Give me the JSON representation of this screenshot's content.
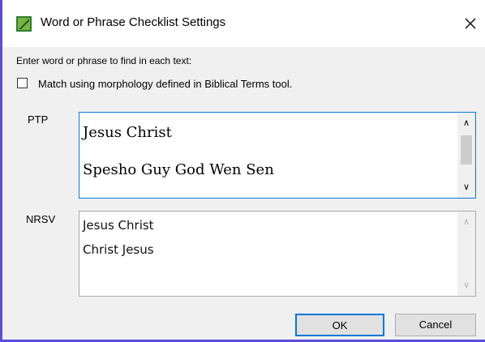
{
  "window": {
    "title": "Word or Phrase Checklist Settings",
    "icon": "app-checklist-icon",
    "accent_color": "#5b4fd9"
  },
  "prompt": "Enter word or phrase to find in each text:",
  "morphology_checkbox": {
    "label": "Match using morphology defined in Biblical Terms tool.",
    "checked": false
  },
  "ptp": {
    "label": "PTP",
    "lines": [
      "Jesus Christ",
      "Spesho Guy God Wen Sen"
    ]
  },
  "nrsv": {
    "label": "NRSV",
    "lines": [
      "Jesus Christ",
      "Christ Jesus"
    ]
  },
  "buttons": {
    "ok": "OK",
    "cancel": "Cancel"
  }
}
